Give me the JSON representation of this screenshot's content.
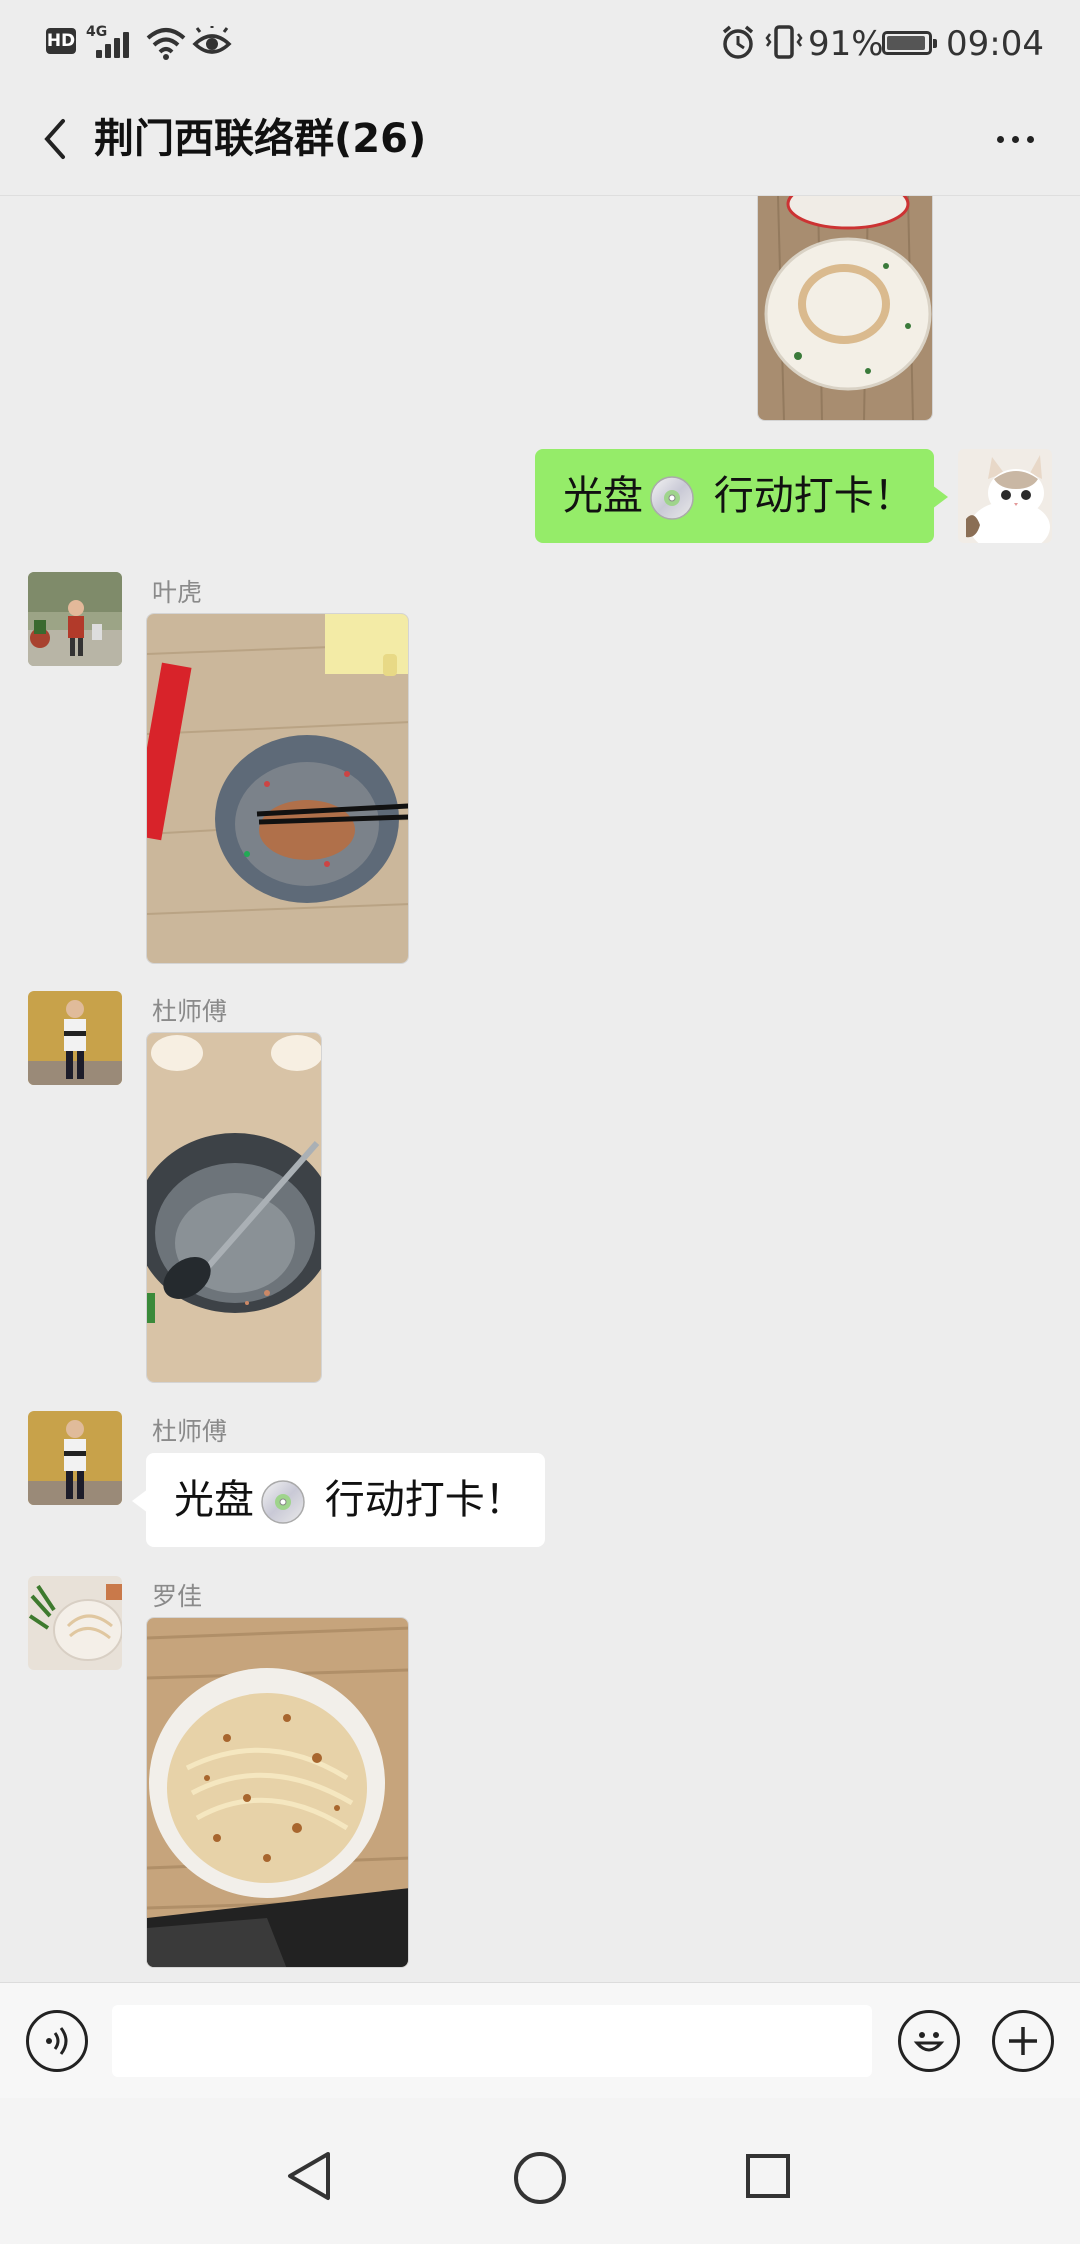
{
  "status_bar": {
    "hd": "HD",
    "network": "4G",
    "battery_percent": "91%",
    "time": "09:04"
  },
  "header": {
    "title": "荆门西联络群(26)",
    "back_icon": "chevron-left-icon",
    "more_icon": "ellipsis-icon"
  },
  "messages": [
    {
      "type": "image",
      "side": "right",
      "description_icon": "photo-bowl-icon"
    },
    {
      "type": "text",
      "side": "right",
      "text_before": "光盘",
      "text_after": " 行动打卡！"
    },
    {
      "type": "image",
      "side": "left",
      "sender": "叶虎"
    },
    {
      "type": "image",
      "side": "left",
      "sender": "杜师傅"
    },
    {
      "type": "text",
      "side": "left",
      "sender": "杜师傅",
      "text_before": "光盘",
      "text_after": " 行动打卡！"
    },
    {
      "type": "image",
      "side": "left",
      "sender": "罗佳"
    }
  ],
  "input_bar": {
    "voice_icon": "voice-icon",
    "emoji_icon": "emoji-icon",
    "plus_icon": "plus-icon",
    "placeholder": ""
  },
  "nav": {
    "back": "triangle-back-icon",
    "home": "circle-home-icon",
    "recent": "square-recent-icon"
  },
  "colors": {
    "background": "#ededed",
    "my_bubble": "#95ec69",
    "their_bubble": "#ffffff"
  }
}
